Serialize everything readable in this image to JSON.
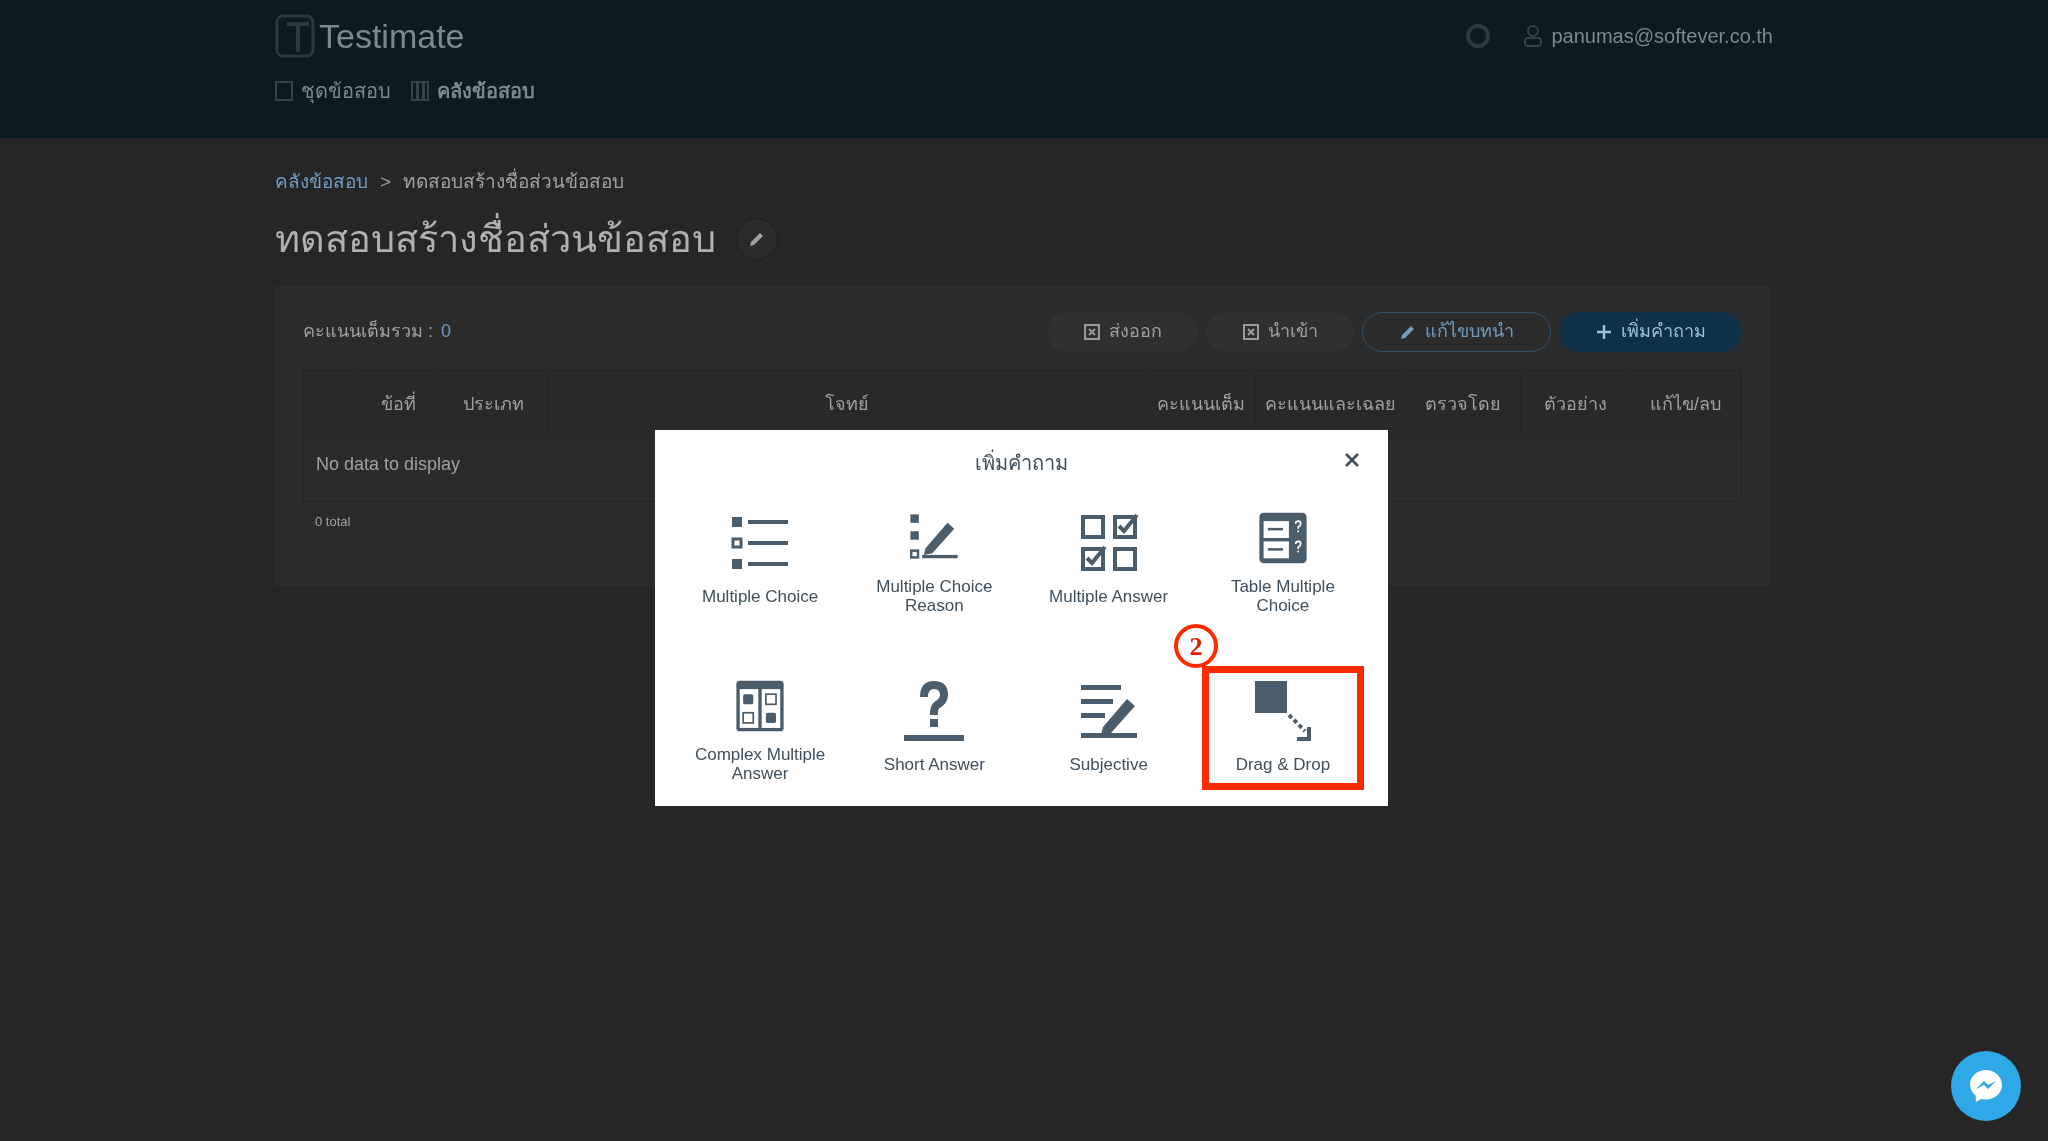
{
  "header": {
    "logo": "Testimate",
    "user_email": "panumas@softever.co.th",
    "nav": [
      {
        "label": "ชุดข้อสอบ",
        "selected": false
      },
      {
        "label": "คลังข้อสอบ",
        "selected": true
      }
    ]
  },
  "breadcrumb": [
    {
      "label": "คลังข้อสอบ",
      "kind": "link"
    },
    {
      "label": ">",
      "kind": "separator"
    },
    {
      "label": "ทดสอบสร้างชื่อส่วนข้อสอบ",
      "kind": "current"
    }
  ],
  "page_title": "ทดสอบสร้างชื่อส่วนข้อสอบ",
  "summary": {
    "label": "คะแนนเต็มรวม :",
    "value": "0"
  },
  "toolbar": [
    {
      "label": "ส่งออก",
      "kind": "export"
    },
    {
      "label": "นำเข้า",
      "kind": "import"
    },
    {
      "label": "แก้ไขบทนำ",
      "kind": "edit"
    },
    {
      "label": "เพิ่มคำถาม",
      "kind": "add"
    }
  ],
  "table": {
    "columns": [
      "ข้อที่",
      "ประเภท",
      "โจทย์",
      "คะแนนเต็ม",
      "คะแนนและเฉลย",
      "ตรวจโดย",
      "ตัวอย่าง",
      "แก้ไข/ลบ"
    ],
    "empty_text": "No data to display",
    "total": "0 total"
  },
  "modal": {
    "title": "เพิ่มคำถาม",
    "options": [
      {
        "label": "Multiple Choice",
        "kind": "list",
        "highlighted": false
      },
      {
        "label": "Multiple Choice Reason",
        "kind": "reason",
        "highlighted": false
      },
      {
        "label": "Multiple Answer",
        "kind": "checks",
        "highlighted": false
      },
      {
        "label": "Table Multiple Choice",
        "kind": "table",
        "highlighted": false
      },
      {
        "label": "Complex Multiple Answer",
        "kind": "complex",
        "highlighted": false
      },
      {
        "label": "Short Answer",
        "kind": "short",
        "highlighted": false
      },
      {
        "label": "Subjective",
        "kind": "subjective",
        "highlighted": false
      },
      {
        "label": "Drag & Drop",
        "kind": "drag",
        "highlighted": true
      }
    ],
    "annotation": "2"
  }
}
